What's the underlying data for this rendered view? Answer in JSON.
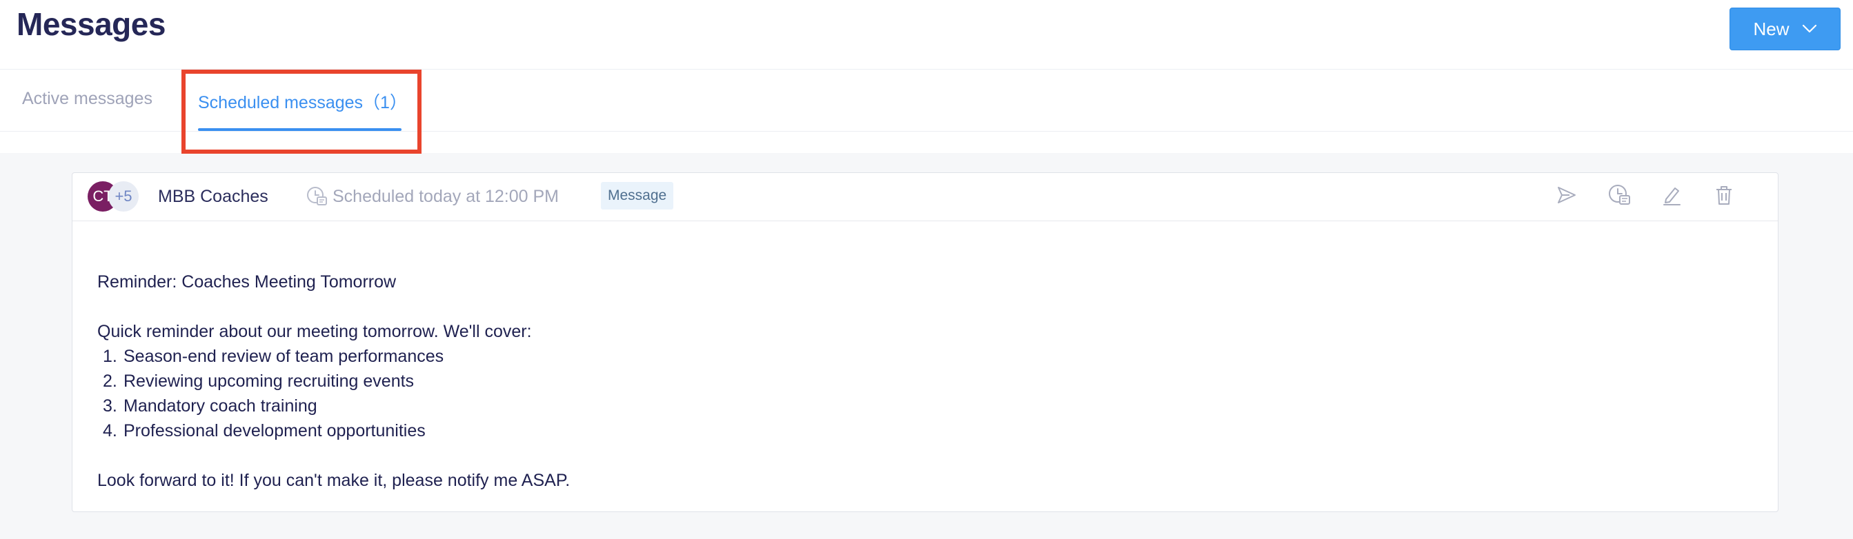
{
  "header": {
    "title": "Messages",
    "new_button_label": "New"
  },
  "tabs": [
    {
      "label": "Active messages"
    },
    {
      "label": "Scheduled messages（1）"
    }
  ],
  "message": {
    "avatar_initials": "CT",
    "avatar_extra_count": "+5",
    "group_name": "MBB Coaches",
    "schedule_text": "Scheduled today at 12:00 PM",
    "type_badge": "Message",
    "subject": "Reminder: Coaches Meeting Tomorrow",
    "intro": "Quick reminder about our meeting tomorrow. We'll cover:",
    "items": [
      {
        "num": "1.",
        "text": "Season-end review of team performances"
      },
      {
        "num": "2.",
        "text": "Reviewing upcoming recruiting events"
      },
      {
        "num": "3.",
        "text": "Mandatory coach training"
      },
      {
        "num": "4.",
        "text": "Professional development opportunities"
      }
    ],
    "closing": "Look forward to it! If you can't make it, please notify me ASAP."
  },
  "icons": {
    "new_dropdown": "chevron-down-icon",
    "schedule": "clock-message-icon",
    "send": "send-icon",
    "reschedule": "reschedule-icon",
    "edit": "edit-icon",
    "delete": "trash-icon"
  },
  "colors": {
    "accent": "#3a8ff0",
    "button": "#3e9bf2",
    "highlight": "#e9442d",
    "avatar": "#7a1f63"
  }
}
